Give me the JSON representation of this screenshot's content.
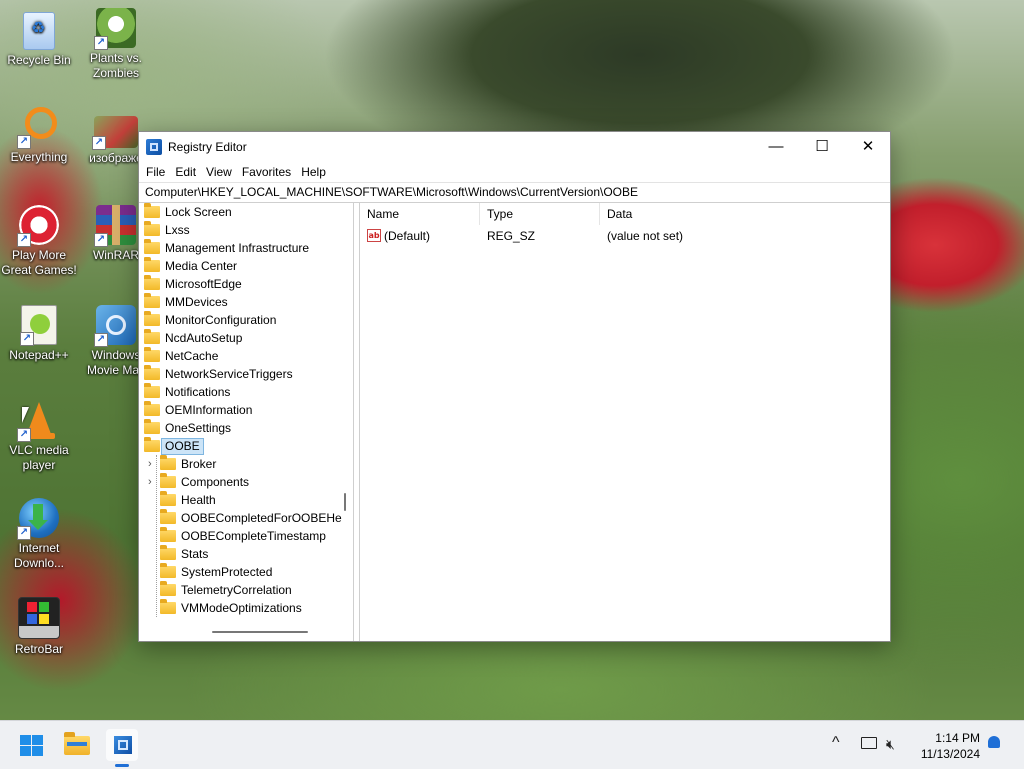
{
  "desktop": {
    "icons": [
      {
        "label": "Recycle Bin"
      },
      {
        "label": "Plants vs. Zombies"
      },
      {
        "label": "Everything"
      },
      {
        "label": "изображе"
      },
      {
        "label": "Play More Great Games!"
      },
      {
        "label": "WinRAR"
      },
      {
        "label": "Notepad++"
      },
      {
        "label": "Windows Movie Mak"
      },
      {
        "label": "VLC media player"
      },
      {
        "label": "Internet Downlo..."
      },
      {
        "label": "RetroBar"
      }
    ]
  },
  "window": {
    "title": "Registry Editor",
    "controls": {
      "minimize": "—",
      "maximize": "☐",
      "close": "✕"
    },
    "menu": [
      "File",
      "Edit",
      "View",
      "Favorites",
      "Help"
    ],
    "address": "Computer\\HKEY_LOCAL_MACHINE\\SOFTWARE\\Microsoft\\Windows\\CurrentVersion\\OOBE",
    "tree": {
      "items": [
        {
          "label": "Lock Screen"
        },
        {
          "label": "Lxss"
        },
        {
          "label": "Management Infrastructure"
        },
        {
          "label": "Media Center"
        },
        {
          "label": "MicrosoftEdge"
        },
        {
          "label": "MMDevices"
        },
        {
          "label": "MonitorConfiguration"
        },
        {
          "label": "NcdAutoSetup"
        },
        {
          "label": "NetCache"
        },
        {
          "label": "NetworkServiceTriggers"
        },
        {
          "label": "Notifications"
        },
        {
          "label": "OEMInformation"
        },
        {
          "label": "OneSettings"
        }
      ],
      "selected": {
        "label": "OOBE"
      },
      "children": [
        {
          "label": "Broker",
          "expandable": true
        },
        {
          "label": "Components",
          "expandable": true
        },
        {
          "label": "Health",
          "expandable": false
        },
        {
          "label": "OOBECompletedForOOBEHe",
          "expandable": false
        },
        {
          "label": "OOBECompleteTimestamp",
          "expandable": false
        },
        {
          "label": "Stats",
          "expandable": false
        },
        {
          "label": "SystemProtected",
          "expandable": false
        },
        {
          "label": "TelemetryCorrelation",
          "expandable": false
        },
        {
          "label": "VMModeOptimizations",
          "expandable": false
        }
      ]
    },
    "list": {
      "columns": {
        "name": "Name",
        "type": "Type",
        "data": "Data"
      },
      "rows": [
        {
          "name": "(Default)",
          "type": "REG_SZ",
          "data": "(value not set)",
          "icon": "ab"
        }
      ]
    }
  },
  "taskbar": {
    "clock": {
      "time": "1:14 PM",
      "date": "11/13/2024"
    },
    "tray": {
      "chevron": "^"
    }
  },
  "colors": {
    "accent": "#1f6fd6",
    "selection": "#cce4f7",
    "folder": "#f2b929"
  }
}
